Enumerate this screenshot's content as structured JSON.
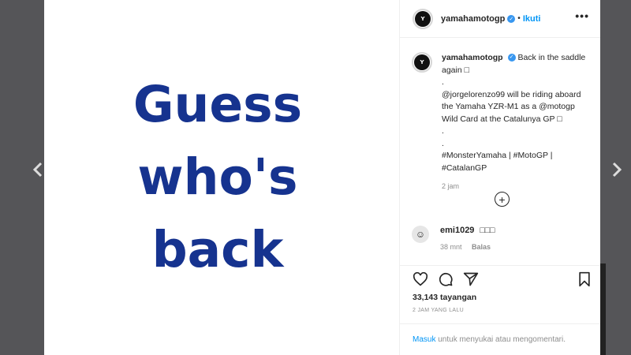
{
  "post": {
    "media_lines": [
      "Guess",
      "who's",
      "back"
    ],
    "author": "yamahamotogp",
    "follow_label": "Ikuti",
    "more_icon_text": "•••",
    "caption": {
      "line1": "Back in the saddle",
      "line2": "again □",
      "sep1": ".",
      "line3": "@jorgelorenzo99 will be riding aboard",
      "line4": "the Yamaha YZR-M1 as a @motogp",
      "line5": "Wild Card at the Catalunya GP □",
      "sep2": ".",
      "sep3": ".",
      "line6": "#MonsterYamaha | #MotoGP |",
      "line7": "#CatalanGP"
    },
    "caption_time": "2 jam",
    "load_more": "+",
    "comment": {
      "user": "emi1029",
      "text": "□□□",
      "time": "38 mnt",
      "reply_label": "Balas"
    },
    "views": "33,143 tayangan",
    "time_ago": "2 JAM YANG LALU",
    "login": {
      "link": "Masuk",
      "rest": " untuk menyukai atau mengomentari."
    }
  },
  "icons": {
    "prev": "chevron-left-icon",
    "next": "chevron-right-icon",
    "like": "heart-icon",
    "comment": "comment-icon",
    "share": "send-icon",
    "save": "bookmark-icon",
    "verified": "verified-badge-icon"
  },
  "colors": {
    "media_text": "#16338f",
    "link": "#0095f6",
    "verified": "#3897f0",
    "muted": "#8e8e8e"
  }
}
